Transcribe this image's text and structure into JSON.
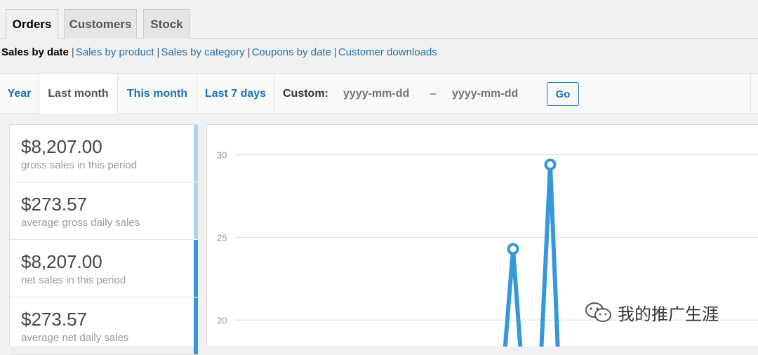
{
  "tabs": [
    "Orders",
    "Customers",
    "Stock"
  ],
  "subnav": {
    "current": "Sales by date",
    "links": [
      "Sales by product",
      "Sales by category",
      "Coupons by date",
      "Customer downloads"
    ]
  },
  "ranges": [
    "Year",
    "Last month",
    "This month",
    "Last 7 days"
  ],
  "active_range": "Last month",
  "custom": {
    "label": "Custom:",
    "from_placeholder": "yyyy-mm-dd",
    "to_placeholder": "yyyy-mm-dd",
    "dash": "–",
    "go_label": "Go"
  },
  "legend": [
    {
      "amount": "$8,207.00",
      "desc": "gross sales in this period",
      "color": "#b1d4ea"
    },
    {
      "amount": "$273.57",
      "desc": "average gross daily sales",
      "color": "#b1d4ea"
    },
    {
      "amount": "$8,207.00",
      "desc": "net sales in this period",
      "color": "#3498db"
    },
    {
      "amount": "$273.57",
      "desc": "average net daily sales",
      "color": "#3498db"
    }
  ],
  "chart_data": {
    "type": "line",
    "ylim": [
      18.4,
      31.8
    ],
    "yticks": [
      "30",
      "25",
      "20"
    ],
    "series": [
      {
        "values": [
          18.0,
          24.3,
          18.0
        ]
      },
      {
        "values": [
          18.0,
          29.4,
          18.0
        ]
      }
    ],
    "color": "#3498db"
  },
  "watermark": {
    "text": "我的推广生涯",
    "icon": "wechat-icon"
  }
}
